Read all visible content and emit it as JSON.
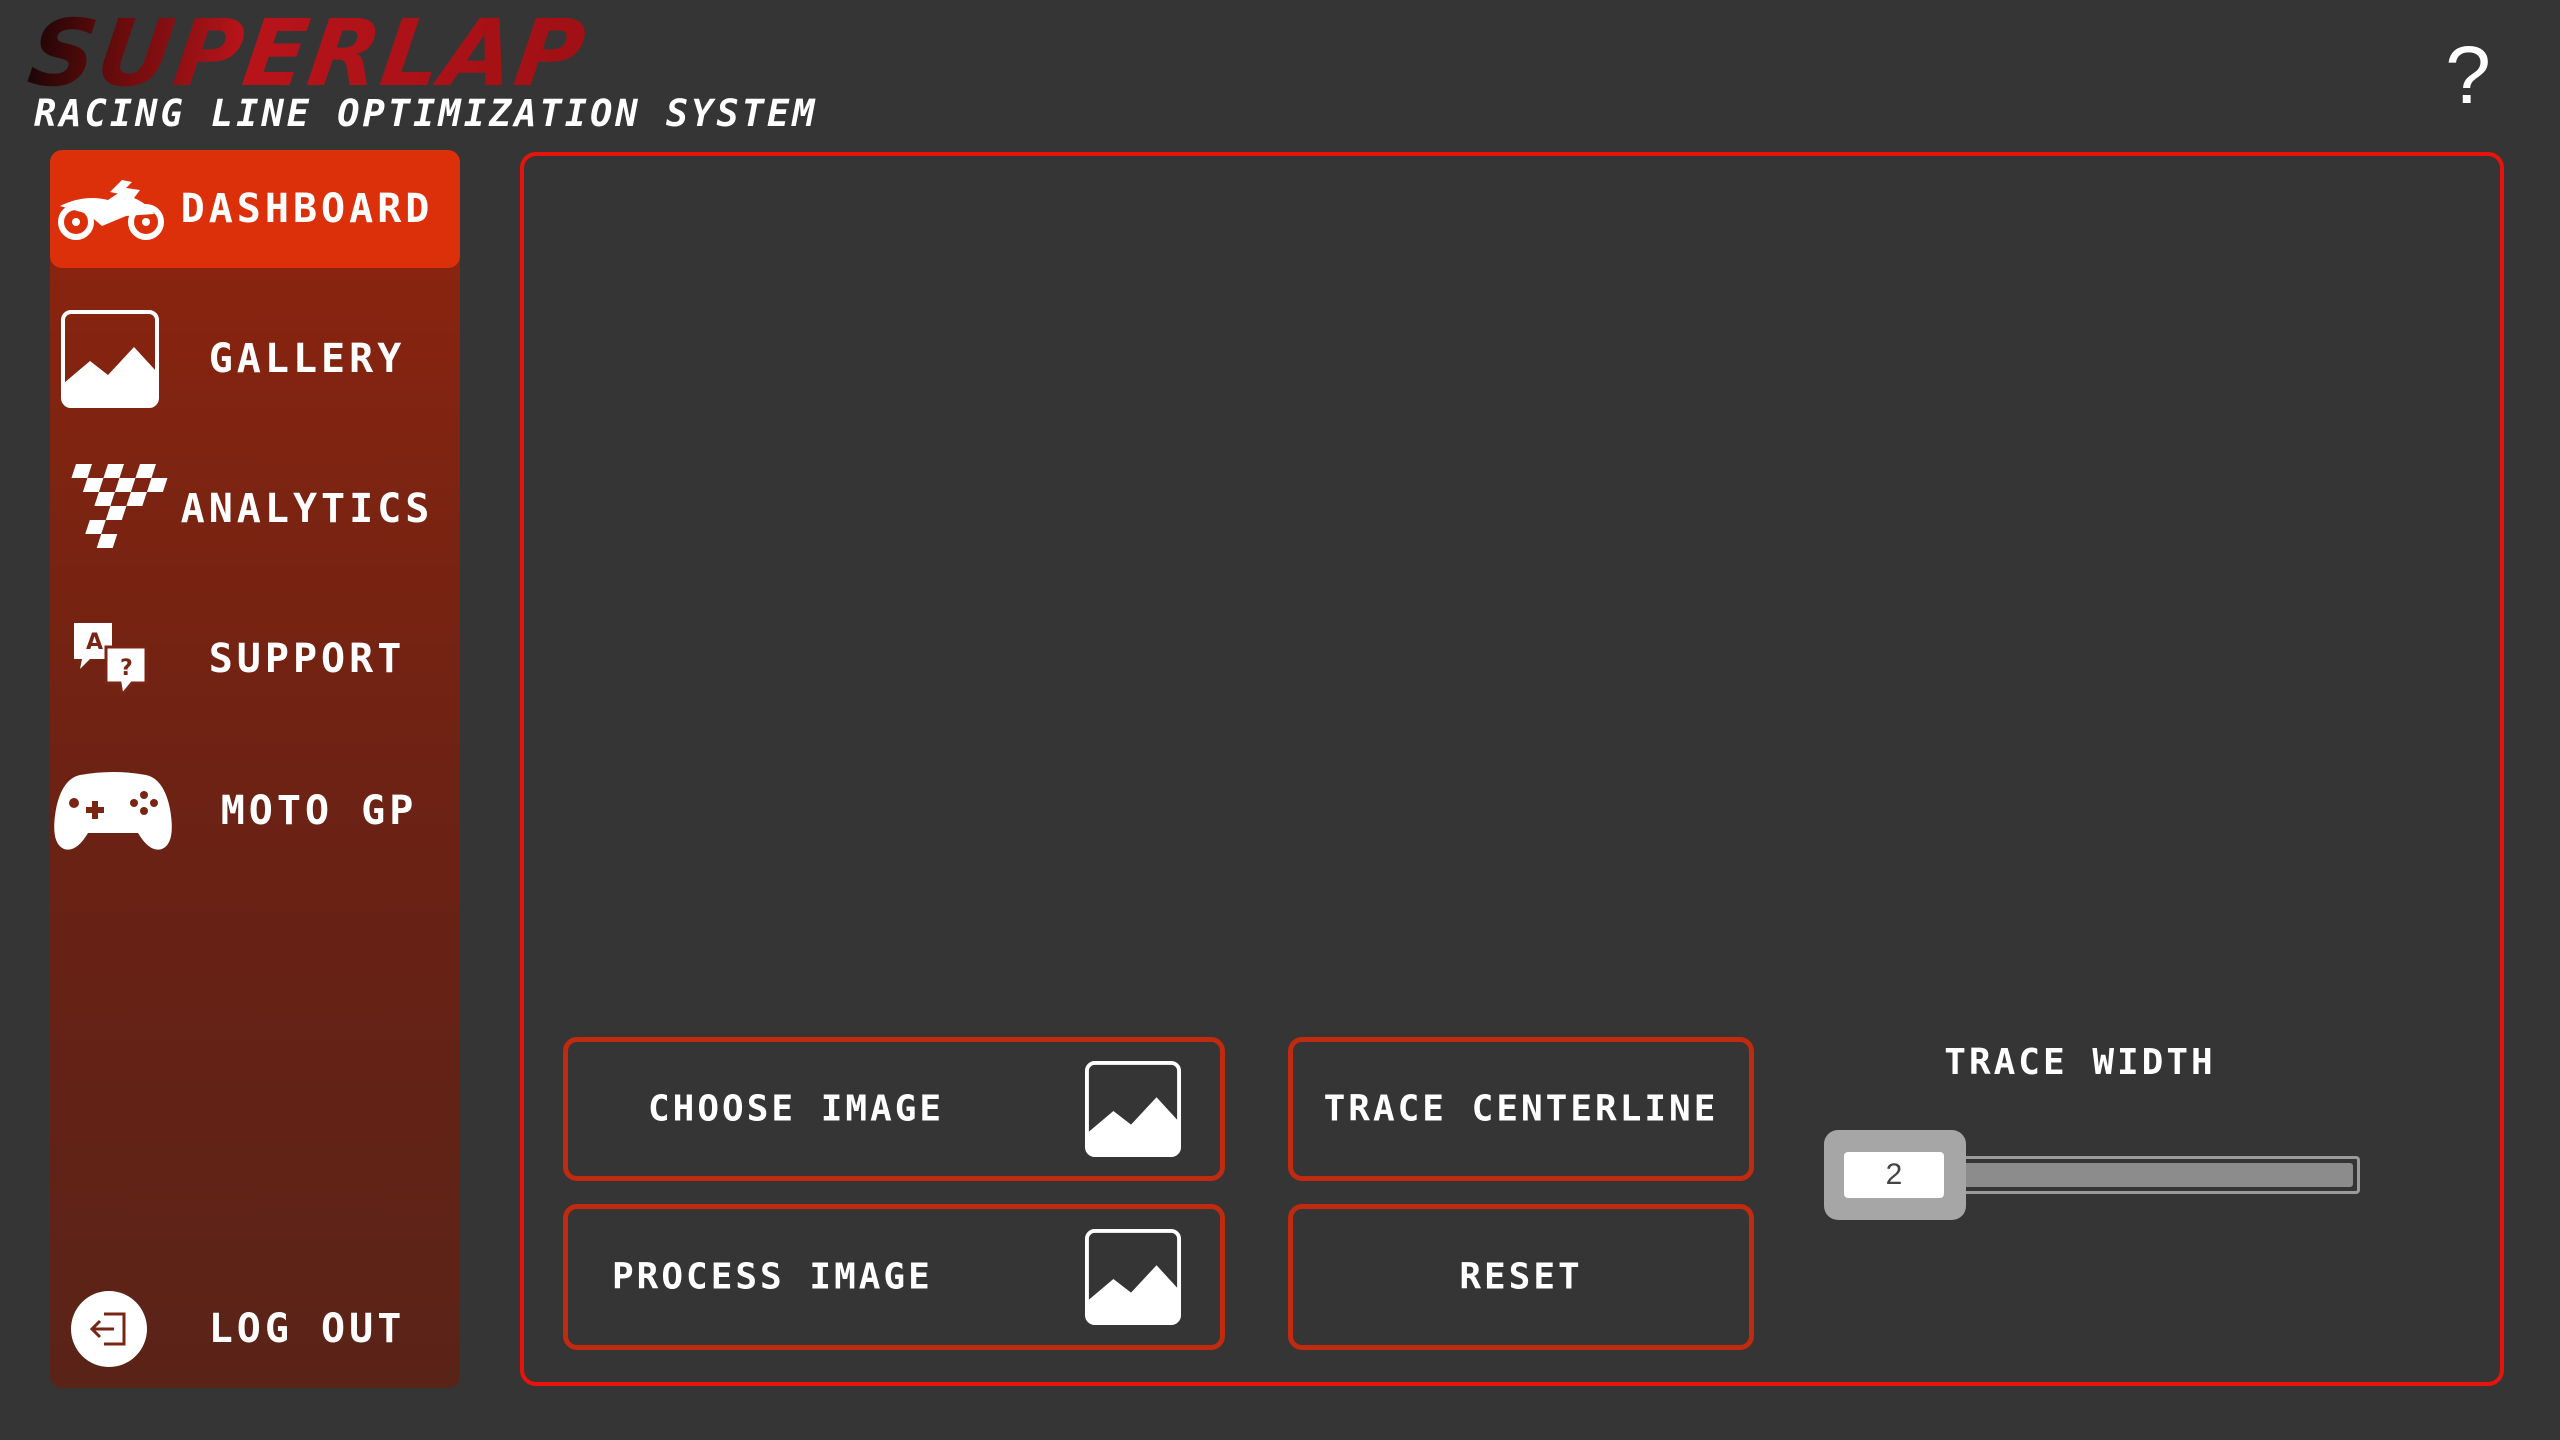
{
  "app": {
    "logo_text": "SUPERLAP",
    "subtitle": "RACING LINE OPTIMIZATION SYSTEM",
    "help_label": "?"
  },
  "colors": {
    "background": "#353535",
    "accent_red": "#e8140c",
    "active_nav": "#dc300a",
    "sidebar_top": "#8e250f",
    "sidebar_bottom": "#5a2318",
    "button_border": "#c02a0e"
  },
  "sidebar": {
    "items": [
      {
        "label": "DASHBOARD",
        "icon": "motorcycle-icon",
        "active": true
      },
      {
        "label": "GALLERY",
        "icon": "image-icon",
        "active": false
      },
      {
        "label": "ANALYTICS",
        "icon": "checkered-flag-icon",
        "active": false
      },
      {
        "label": "SUPPORT",
        "icon": "speech-bubbles-icon",
        "active": false
      },
      {
        "label": "MOTO GP",
        "icon": "gamepad-icon",
        "active": false
      }
    ],
    "logout": {
      "label": "LOG OUT",
      "icon": "logout-icon"
    }
  },
  "controls": {
    "choose_image": {
      "label": "CHOOSE IMAGE",
      "icon": "image-icon"
    },
    "process_image": {
      "label": "PROCESS IMAGE",
      "icon": "image-icon"
    },
    "trace_centerline": {
      "label": "TRACE CENTERLINE"
    },
    "reset": {
      "label": "RESET"
    },
    "trace_width": {
      "label": "TRACE WIDTH",
      "value": "2",
      "level_percent": 100
    }
  }
}
